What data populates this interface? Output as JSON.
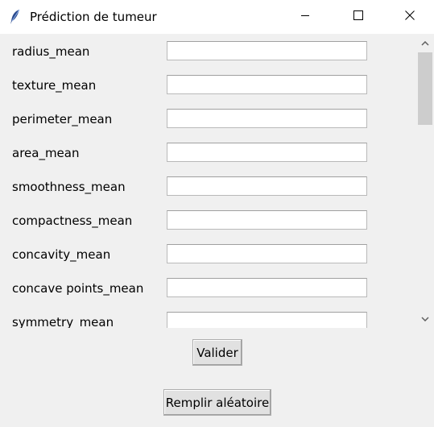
{
  "window": {
    "title": "Prédiction de tumeur",
    "icon": "feather-icon",
    "controls": [
      "minimize-icon",
      "maximize-icon",
      "close-icon"
    ]
  },
  "fields": [
    {
      "label": "radius_mean",
      "value": ""
    },
    {
      "label": "texture_mean",
      "value": ""
    },
    {
      "label": "perimeter_mean",
      "value": ""
    },
    {
      "label": "area_mean",
      "value": ""
    },
    {
      "label": "smoothness_mean",
      "value": ""
    },
    {
      "label": "compactness_mean",
      "value": ""
    },
    {
      "label": "concavity_mean",
      "value": ""
    },
    {
      "label": "concave points_mean",
      "value": ""
    },
    {
      "label": "symmetry_mean",
      "value": ""
    }
  ],
  "scrollbar": {
    "position": 0.0
  },
  "buttons": {
    "validate_label": "Valider",
    "random_label": "Remplir aléatoire"
  },
  "colors": {
    "background": "#f0f0f0",
    "titlebar": "#ffffff",
    "button": "#e1e1e1"
  }
}
